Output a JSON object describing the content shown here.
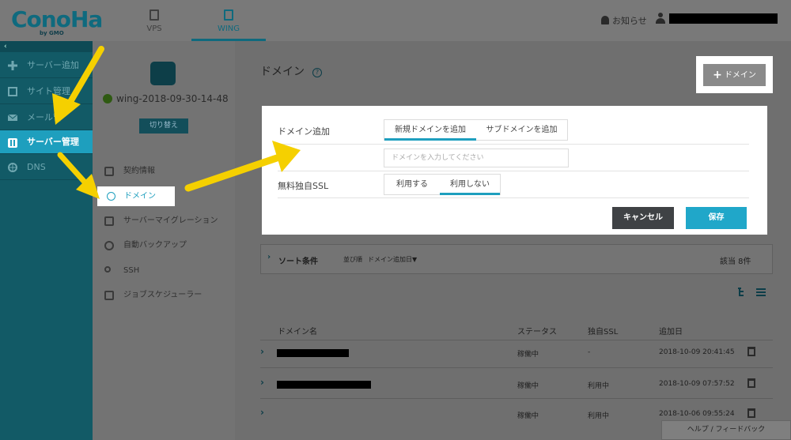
{
  "brand": {
    "logo": "ConoHa",
    "sub": "by GMO"
  },
  "top_tabs": [
    {
      "label": "VPS",
      "icon": "server-stack-icon"
    },
    {
      "label": "WING",
      "icon": "wing-server-icon"
    }
  ],
  "header": {
    "notice_label": "お知らせ"
  },
  "sidebar": {
    "collapse_glyph": "‹",
    "items": [
      {
        "label": "サーバー追加",
        "icon": "plus-icon"
      },
      {
        "label": "サイト管理",
        "icon": "site-icon"
      },
      {
        "label": "メール管",
        "icon": "mail-icon"
      },
      {
        "label": "サーバー管理",
        "icon": "server-icon"
      },
      {
        "label": "DNS",
        "icon": "globe-icon"
      }
    ]
  },
  "server": {
    "name": "wing-2018-09-30-14-48",
    "switch_label": "切り替え"
  },
  "submenu": [
    {
      "label": "契約情報",
      "icon": "contract-icon"
    },
    {
      "label": "ドメイン",
      "icon": "www-icon"
    },
    {
      "label": "サーバーマイグレーション",
      "icon": "migration-icon"
    },
    {
      "label": "自動バックアップ",
      "icon": "backup-icon"
    },
    {
      "label": "SSH",
      "icon": "key-icon"
    },
    {
      "label": "ジョブスケジューラー",
      "icon": "scheduler-icon"
    }
  ],
  "main": {
    "title": "ドメイン",
    "help_glyph": "?",
    "add_button_label": "ドメイン",
    "add_glyph": "+"
  },
  "modal": {
    "domain_add_label": "ドメイン追加",
    "domain_options": [
      "新規ドメインを追加",
      "サブドメインを追加"
    ],
    "domain_input_placeholder": "ドメインを入力してください",
    "ssl_label": "無料独自SSL",
    "ssl_options": [
      "利用する",
      "利用しない"
    ],
    "cancel_label": "キャンセル",
    "save_label": "保存"
  },
  "sort": {
    "chevron": "›",
    "label": "ソート条件",
    "order_label": "並び順",
    "order_value": "ドメイン追加日▼",
    "count_label": "該当 8件"
  },
  "table": {
    "headers": [
      "ドメイン名",
      "ステータス",
      "独自SSL",
      "追加日"
    ],
    "rows": [
      {
        "status": "稼働中",
        "ssl": "-",
        "date": "2018-10-09 20:41:45"
      },
      {
        "status": "稼働中",
        "ssl": "利用中",
        "date": "2018-10-09 07:57:52"
      },
      {
        "status": "稼働中",
        "ssl": "利用中",
        "date": "2018-10-06 09:55:24"
      }
    ]
  },
  "footer": {
    "feedback_label": "ヘルプ / フィードバック"
  },
  "colors": {
    "accent": "#1e9fbe",
    "arrow": "#f5d000",
    "sidebar": "#125a66"
  }
}
